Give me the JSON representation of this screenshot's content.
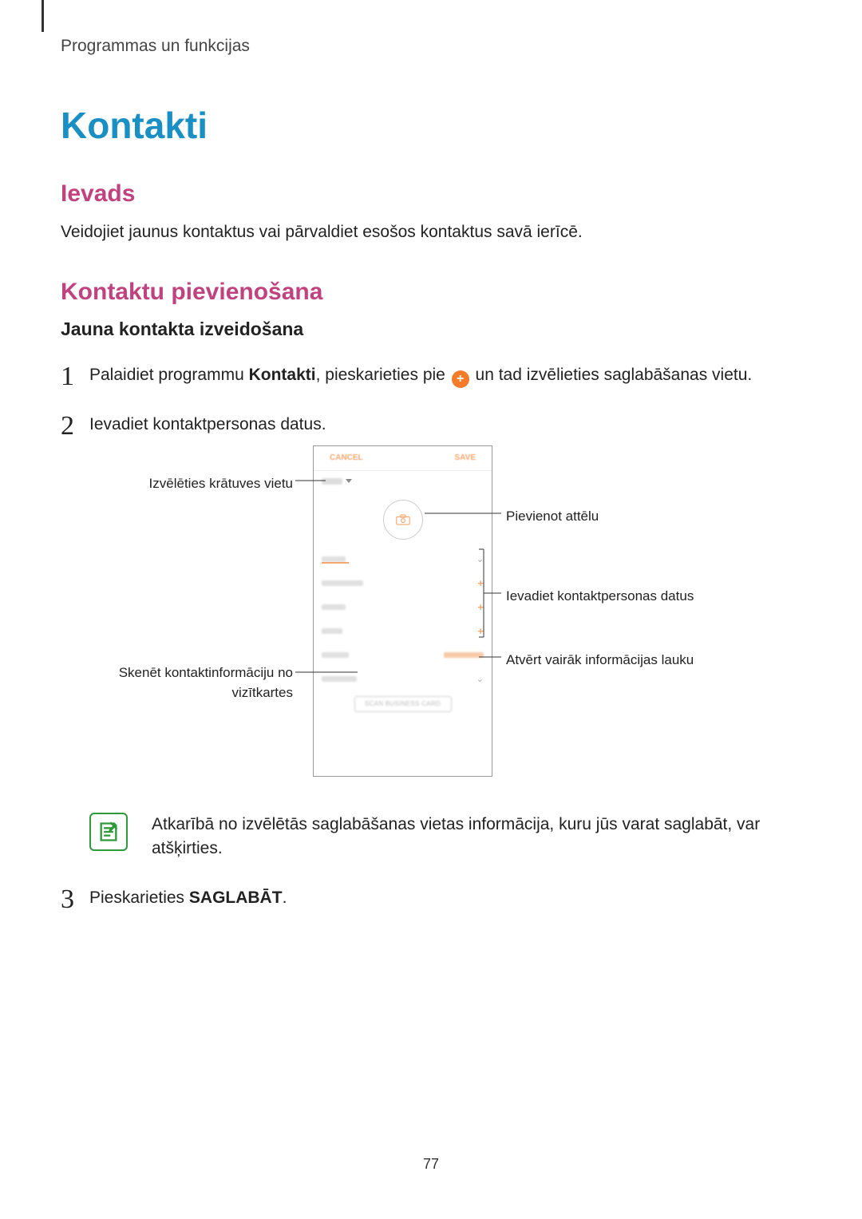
{
  "header": {
    "breadcrumb": "Programmas un funkcijas"
  },
  "title": "Kontakti",
  "sections": {
    "intro_heading": "Ievads",
    "intro_body": "Veidojiet jaunus kontaktus vai pārvaldiet esošos kontaktus savā ierīcē.",
    "add_heading": "Kontaktu pievienošana",
    "add_sub": "Jauna kontakta izveidošana"
  },
  "steps": {
    "s1_part1": "Palaidiet programmu ",
    "s1_bold": "Kontakti",
    "s1_part2": ", pieskarieties pie ",
    "s1_part3": " un tad izvēlieties saglabāšanas vietu.",
    "s2": "Ievadiet kontaktpersonas datus.",
    "s3_part1": "Pieskarieties ",
    "s3_bold": "SAGLABĀT",
    "s3_part2": "."
  },
  "callouts": {
    "select_storage": "Izvēlēties krātuves vietu",
    "add_image": "Pievienot attēlu",
    "enter_data": "Ievadiet kontaktpersonas datus",
    "more_fields": "Atvērt vairāk informācijas lauku",
    "scan_line1": "Skenēt kontaktinformāciju no",
    "scan_line2": "vizītkartes"
  },
  "phone": {
    "top_left": "CANCEL",
    "top_right": "SAVE",
    "groups_left": "Groups",
    "groups_right": "Not assigned",
    "scan_button": "SCAN BUSINESS CARD"
  },
  "note": {
    "text": "Atkarībā no izvēlētās saglabāšanas vietas informācija, kuru jūs varat saglabāt, var atšķirties."
  },
  "icons": {
    "plus": "+"
  },
  "page_number": "77"
}
